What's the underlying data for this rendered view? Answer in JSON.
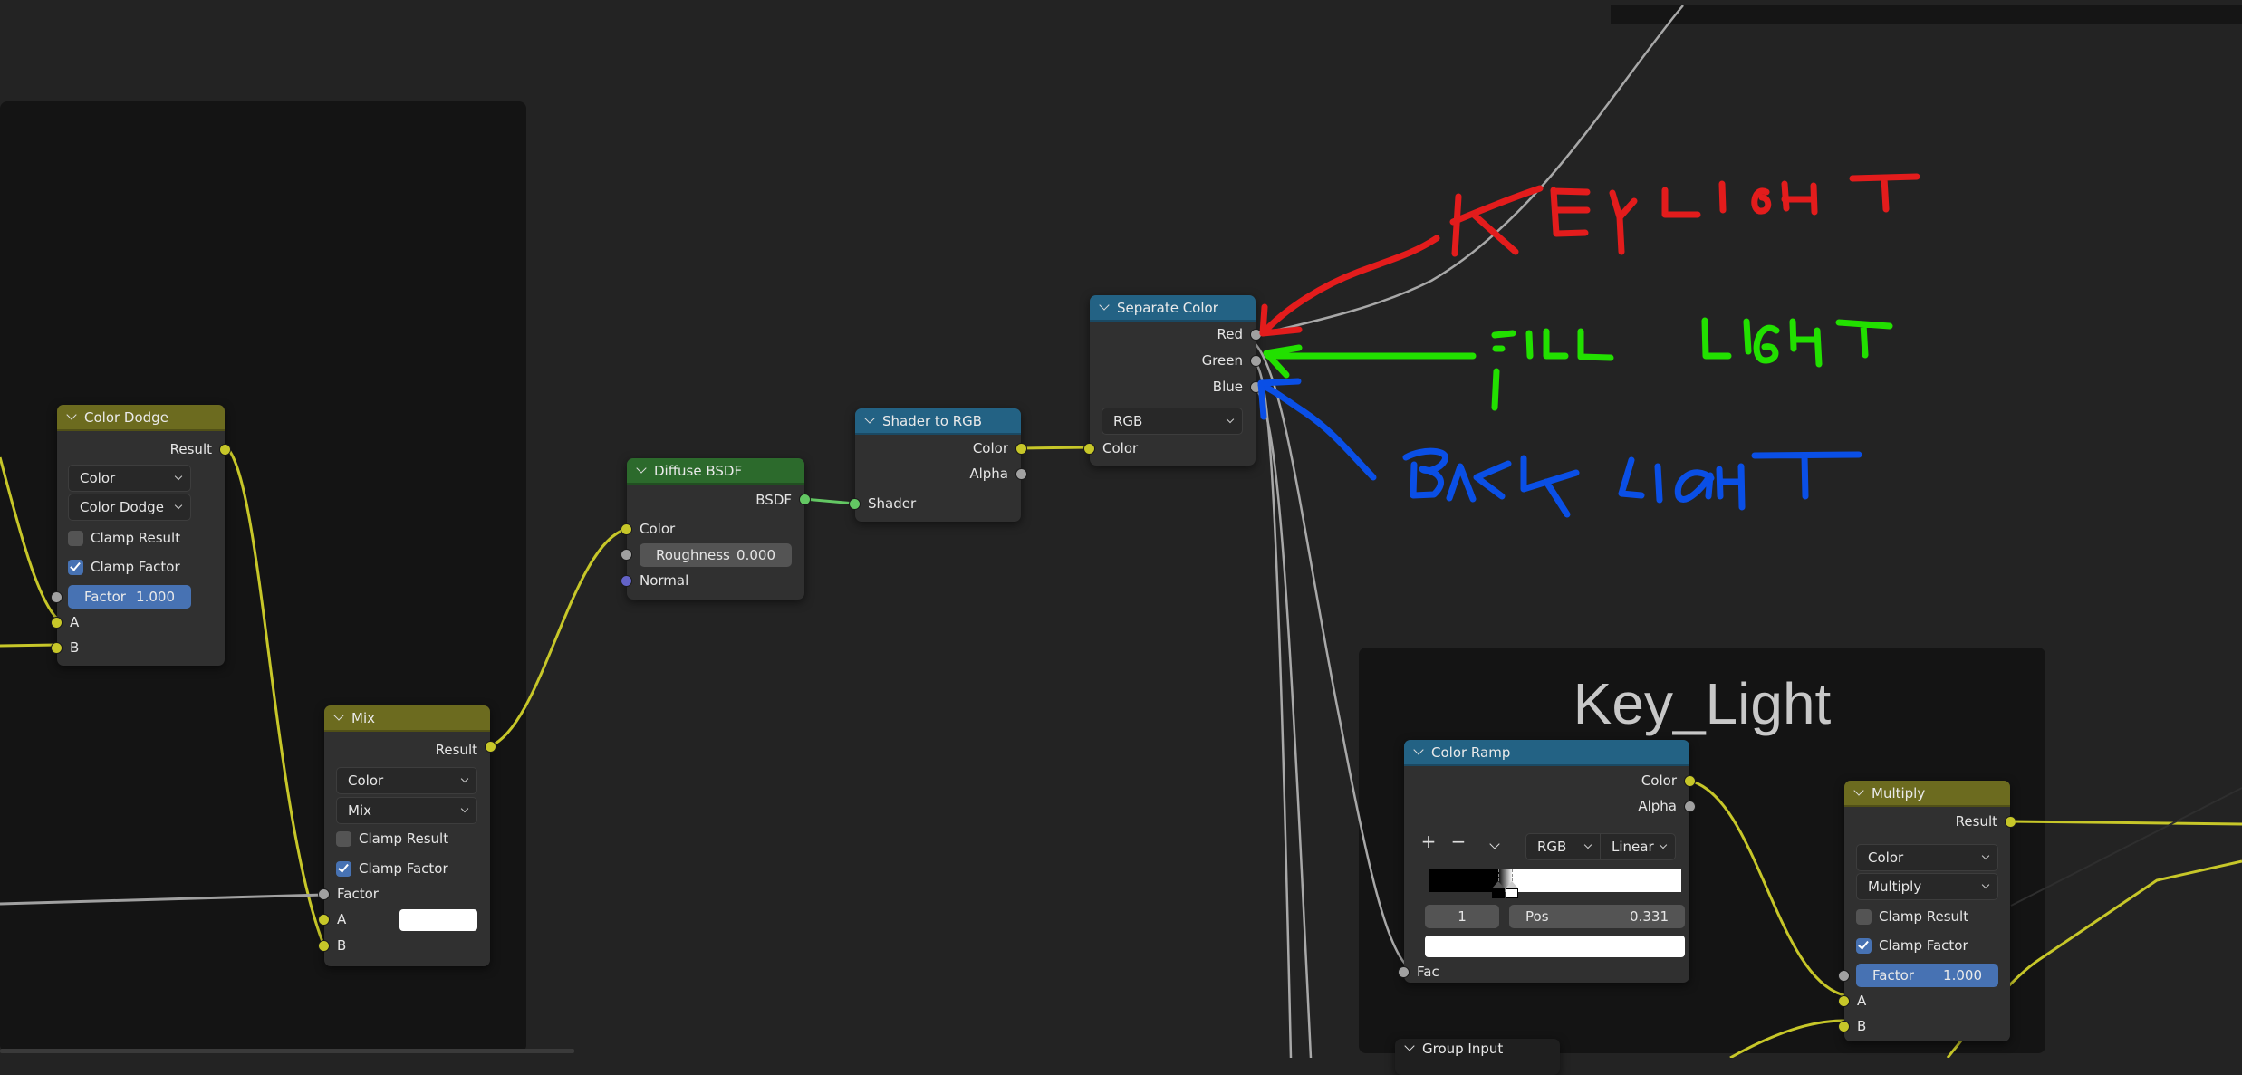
{
  "frames": {
    "key_light": {
      "label": "Key_Light"
    }
  },
  "nodes": {
    "color_dodge": {
      "title": "Color Dodge",
      "output": "Result",
      "data_type": "Color",
      "blend_mode": "Color Dodge",
      "clamp_result_label": "Clamp Result",
      "clamp_result": false,
      "clamp_factor_label": "Clamp Factor",
      "clamp_factor": true,
      "factor_label": "Factor",
      "factor_value": "1.000",
      "input_a": "A",
      "input_b": "B"
    },
    "mix": {
      "title": "Mix",
      "output": "Result",
      "data_type": "Color",
      "blend_mode": "Mix",
      "clamp_result_label": "Clamp Result",
      "clamp_result": false,
      "clamp_factor_label": "Clamp Factor",
      "clamp_factor": true,
      "factor_label": "Factor",
      "input_a": "A",
      "input_b": "B",
      "a_color": "#ffffff"
    },
    "diffuse_bsdf": {
      "title": "Diffuse BSDF",
      "output": "BSDF",
      "input_color": "Color",
      "roughness_label": "Roughness",
      "roughness_value": "0.000",
      "input_normal": "Normal"
    },
    "shader_to_rgb": {
      "title": "Shader to RGB",
      "output_color": "Color",
      "output_alpha": "Alpha",
      "input_shader": "Shader"
    },
    "separate_color": {
      "title": "Separate Color",
      "output_red": "Red",
      "output_green": "Green",
      "output_blue": "Blue",
      "mode": "RGB",
      "input_color": "Color"
    },
    "color_ramp": {
      "title": "Color Ramp",
      "output_color": "Color",
      "output_alpha": "Alpha",
      "add_label": "+",
      "remove_label": "−",
      "color_mode": "RGB",
      "interpolation": "Linear",
      "active_stop_index": "1",
      "pos_label": "Pos",
      "pos_value": "0.331",
      "stops": [
        {
          "position": 0.275,
          "color": "#000000"
        },
        {
          "position": 0.331,
          "color": "#ffffff"
        }
      ],
      "active_color": "#ffffff",
      "input_fac": "Fac"
    },
    "multiply": {
      "title": "Multiply",
      "output": "Result",
      "data_type": "Color",
      "blend_mode": "Multiply",
      "clamp_result_label": "Clamp Result",
      "clamp_result": false,
      "clamp_factor_label": "Clamp Factor",
      "clamp_factor": true,
      "factor_label": "Factor",
      "factor_value": "1.000",
      "input_a": "A",
      "input_b": "B"
    },
    "group_input": {
      "title": "Group Input"
    }
  },
  "annotations": [
    {
      "text": "KEY LIGHT",
      "color": "#e31c1c",
      "points_to": "Red"
    },
    {
      "text": "FILL LIGHT",
      "color": "#22e000",
      "points_to": "Green"
    },
    {
      "text": "BACK LIGHT",
      "color": "#0a4fe6",
      "points_to": "Blue"
    }
  ],
  "colors": {
    "socket_color": "#c7c729",
    "socket_float": "#a1a1a1",
    "socket_shader": "#63c763",
    "socket_vector": "#6363c7",
    "header_converter": "#6c6b1f",
    "header_shader": "#2c6a2c",
    "header_color": "#236284",
    "slider_blue": "#4772b3"
  }
}
